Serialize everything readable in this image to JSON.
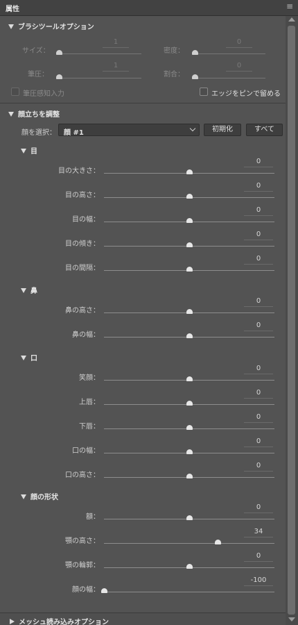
{
  "window": {
    "title": "属性"
  },
  "brush": {
    "title": "ブラシツールオプション",
    "size": {
      "label": "サイズ：",
      "value": "1"
    },
    "density": {
      "label": "密度：",
      "value": "0"
    },
    "pressure": {
      "label": "筆圧：",
      "value": "1"
    },
    "rate": {
      "label": "割合：",
      "value": "0"
    },
    "pen_pressure_label": "筆圧感知入力",
    "pin_edges_label": "エッジをピンで留める"
  },
  "face": {
    "title": "顔立ちを調整",
    "select_label": "顔を選択：",
    "select_value": "顔 #1",
    "reset_label": "初期化",
    "all_label": "すべて",
    "groups": [
      {
        "title": "目",
        "sliders": [
          {
            "label": "目の大きさ：",
            "value": "0",
            "fraction": 0.5
          },
          {
            "label": "目の高さ：",
            "value": "0",
            "fraction": 0.5
          },
          {
            "label": "目の幅：",
            "value": "0",
            "fraction": 0.5
          },
          {
            "label": "目の傾き：",
            "value": "0",
            "fraction": 0.5
          },
          {
            "label": "目の間隔：",
            "value": "0",
            "fraction": 0.5
          }
        ]
      },
      {
        "title": "鼻",
        "sliders": [
          {
            "label": "鼻の高さ：",
            "value": "0",
            "fraction": 0.5
          },
          {
            "label": "鼻の幅：",
            "value": "0",
            "fraction": 0.5
          }
        ]
      },
      {
        "title": "口",
        "sliders": [
          {
            "label": "笑顔：",
            "value": "0",
            "fraction": 0.5
          },
          {
            "label": "上唇：",
            "value": "0",
            "fraction": 0.5
          },
          {
            "label": "下唇：",
            "value": "0",
            "fraction": 0.5
          },
          {
            "label": "口の幅：",
            "value": "0",
            "fraction": 0.5
          },
          {
            "label": "口の高さ：",
            "value": "0",
            "fraction": 0.5
          }
        ]
      },
      {
        "title": "顔の形状",
        "sliders": [
          {
            "label": "額：",
            "value": "0",
            "fraction": 0.5
          },
          {
            "label": "顎の高さ：",
            "value": "34",
            "fraction": 0.67
          },
          {
            "label": "顎の輪郭：",
            "value": "0",
            "fraction": 0.5
          },
          {
            "label": "顔の幅：",
            "value": "-100",
            "fraction": 0.0
          }
        ]
      }
    ]
  },
  "mesh": {
    "title": "メッシュ読み込みオプション"
  }
}
